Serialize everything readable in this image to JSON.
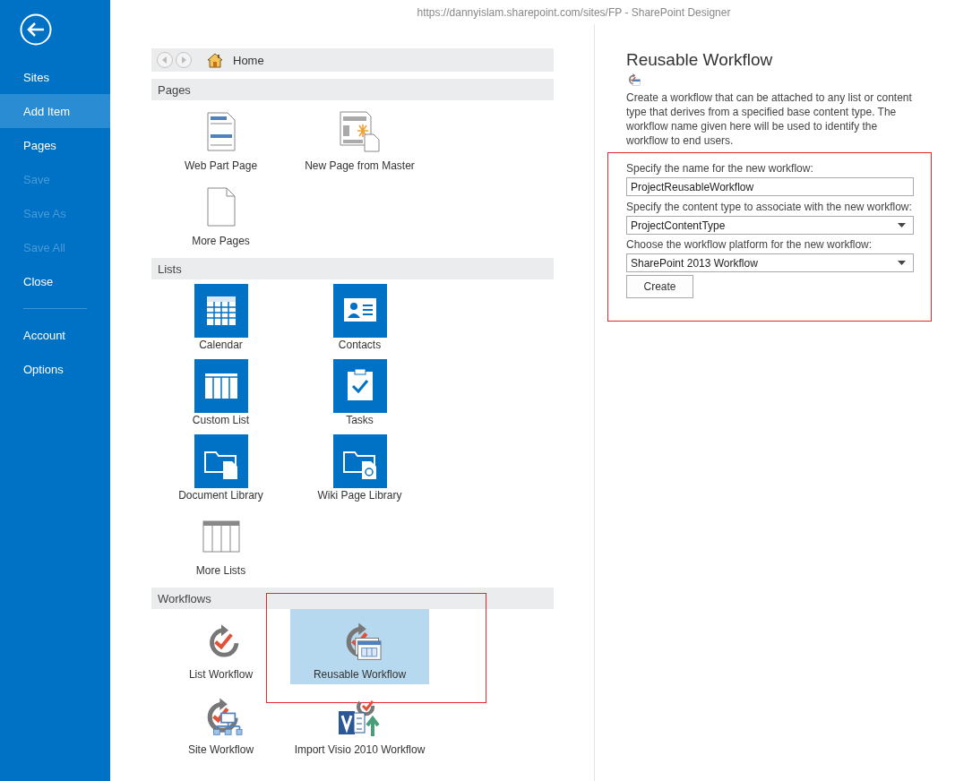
{
  "window": {
    "title": "https://dannyislam.sharepoint.com/sites/FP - SharePoint Designer"
  },
  "sidebar": {
    "items": [
      {
        "label": "Sites",
        "selected": false,
        "disabled": false,
        "separator_before": false
      },
      {
        "label": "Add Item",
        "selected": true,
        "disabled": false,
        "separator_before": false
      },
      {
        "label": "Pages",
        "selected": false,
        "disabled": false,
        "separator_before": false
      },
      {
        "label": "Save",
        "selected": false,
        "disabled": true,
        "separator_before": false
      },
      {
        "label": "Save As",
        "selected": false,
        "disabled": true,
        "separator_before": false
      },
      {
        "label": "Save All",
        "selected": false,
        "disabled": true,
        "separator_before": false
      },
      {
        "label": "Close",
        "selected": false,
        "disabled": false,
        "separator_before": false
      },
      {
        "label": "Account",
        "selected": false,
        "disabled": false,
        "separator_before": true
      },
      {
        "label": "Options",
        "selected": false,
        "disabled": false,
        "separator_before": false
      }
    ]
  },
  "breadcrumb": {
    "label": "Home"
  },
  "sections": [
    {
      "title": "Pages",
      "items": [
        {
          "label": "Web Part Page",
          "kind": "webpart",
          "selected": false,
          "outlined": false
        },
        {
          "label": "New Page from Master",
          "kind": "master",
          "selected": false,
          "outlined": false
        },
        {
          "label": "More Pages",
          "kind": "blank",
          "selected": false,
          "outlined": false
        }
      ]
    },
    {
      "title": "Lists",
      "items": [
        {
          "label": "Calendar",
          "kind": "calendar",
          "selected": false,
          "outlined": false
        },
        {
          "label": "Contacts",
          "kind": "contacts",
          "selected": false,
          "outlined": false
        },
        {
          "label": "Custom List",
          "kind": "customlist",
          "selected": false,
          "outlined": false
        },
        {
          "label": "Tasks",
          "kind": "tasks",
          "selected": false,
          "outlined": false
        },
        {
          "label": "Document Library",
          "kind": "doclib",
          "selected": false,
          "outlined": false
        },
        {
          "label": "Wiki Page Library",
          "kind": "wikilib",
          "selected": false,
          "outlined": false
        },
        {
          "label": "More Lists",
          "kind": "morelists",
          "selected": false,
          "outlined": false
        }
      ]
    },
    {
      "title": "Workflows",
      "items": [
        {
          "label": "List Workflow",
          "kind": "listwf",
          "selected": false,
          "outlined": false
        },
        {
          "label": "Reusable Workflow",
          "kind": "reusablewf",
          "selected": true,
          "outlined": true
        },
        {
          "label": "Site Workflow",
          "kind": "sitewf",
          "selected": false,
          "outlined": false
        },
        {
          "label": "Import Visio 2010 Workflow",
          "kind": "visio",
          "selected": false,
          "outlined": false
        }
      ]
    }
  ],
  "details": {
    "title": "Reusable Workflow",
    "description": "Create a workflow that can be attached to any list or content type that derives from a specified base content type.  The workflow name given here will be used to identify the workflow to end users.",
    "outlined": true,
    "fields": [
      {
        "label": "Specify the name for the new workflow:",
        "kind": "text",
        "value": "ProjectReusableWorkflow"
      },
      {
        "label": "Specify the content type to associate with the new workflow:",
        "kind": "dropdown",
        "value": "ProjectContentType"
      },
      {
        "label": "Choose the workflow platform for the new workflow:",
        "kind": "dropdown",
        "value": "SharePoint 2013 Workflow"
      }
    ],
    "button": "Create"
  }
}
